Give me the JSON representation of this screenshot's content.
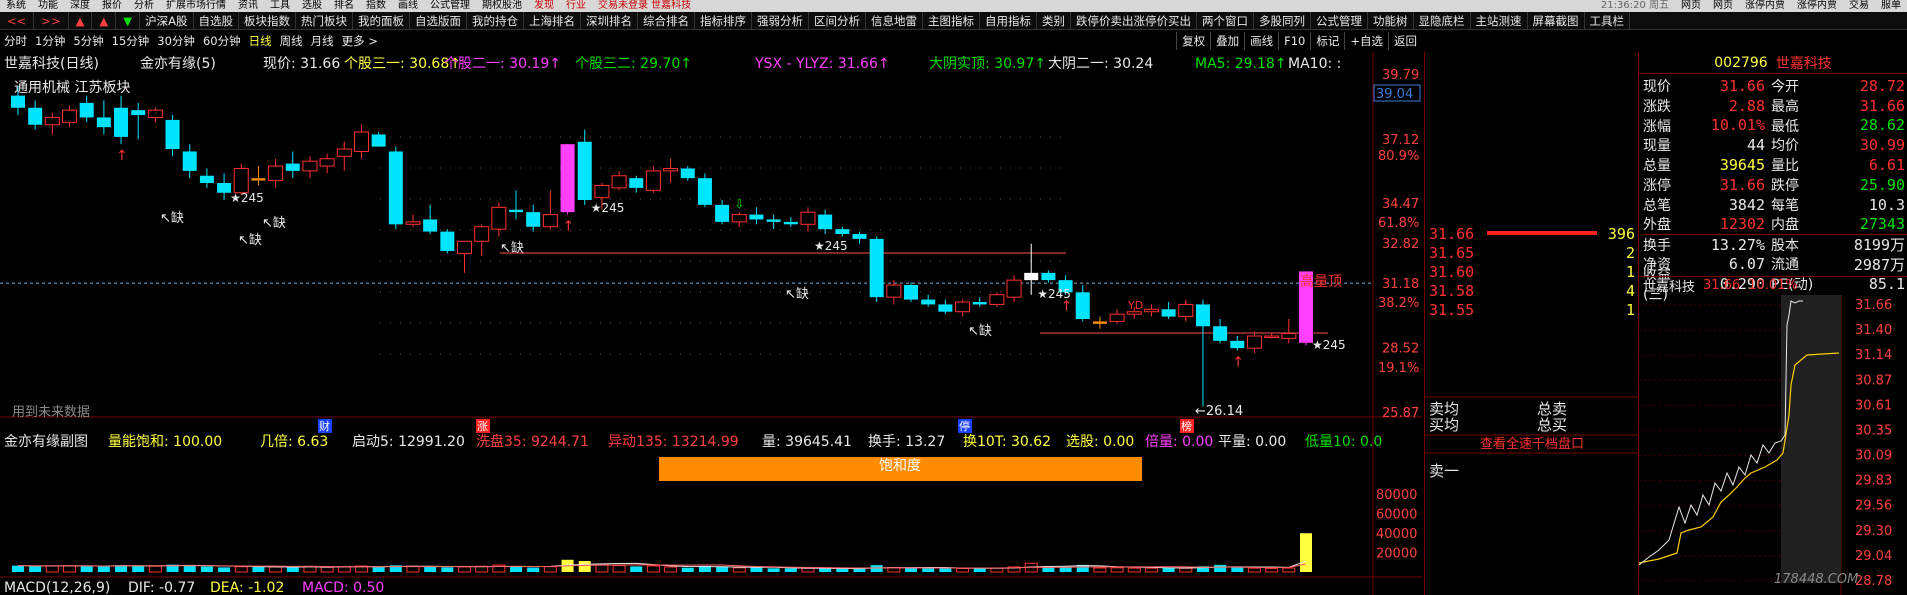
{
  "menubar": {
    "items": [
      "系统",
      "功能",
      "深度",
      "报价",
      "分析",
      "扩展市场行情",
      "资讯",
      "工具",
      "选股",
      "排名",
      "指数",
      "画线",
      "公式管理",
      "期权股池",
      "发现",
      "行业"
    ],
    "warning": "交易未登录   世嘉科技",
    "clock": "21:36:20 周五",
    "right": [
      "网页",
      "网页",
      "涨停内贾",
      "涨停内贾",
      "交易",
      "服单"
    ]
  },
  "toolbar1": {
    "nav": [
      "<<",
      ">>",
      "▲",
      "▲",
      "▼"
    ],
    "items": [
      "沪深A股",
      "自选股",
      "板块指数",
      "热门板块",
      "我的面板",
      "自选版面",
      "我的持仓",
      "上海排名",
      "深圳排名",
      "综合排名",
      "指标排序",
      "强弱分析",
      "区间分析",
      "信息地雷",
      "主图指标",
      "自用指标",
      "类别",
      "跌停价卖出涨停价买出",
      "两个窗口",
      "多股同列",
      "公式管理",
      "功能树",
      "显隐底栏",
      "主站测速",
      "屏幕截图",
      "工具栏"
    ]
  },
  "toolbar2": {
    "periods": [
      "分时",
      "1分钟",
      "5分钟",
      "15分钟",
      "30分钟",
      "60分钟",
      "日线",
      "周线",
      "月线",
      "更多 >"
    ],
    "active": "日线",
    "right": [
      "复权",
      "叠加",
      "画线",
      "F10",
      "标记",
      "+自选",
      "返回"
    ]
  },
  "chart": {
    "title": "世嘉科技(日线)",
    "formula": "金亦有缘(5)",
    "price_label": "现价: 31.66",
    "ind1": "个股三一: 30.68",
    "ind2": "个股二一: 30.19",
    "ind3": "个股三二: 29.70",
    "ysx": "YSX - YLYZ: 31.66",
    "dayin": "大阴实顶: 30.97",
    "dayin2": "大阴二一: 30.24",
    "ma5": "MA5: 29.18",
    "ma10": "MA10: :",
    "sector": "通用机械  江苏板块",
    "future_note": "用到未来数据",
    "price_axis": [
      "39.79",
      "37.12",
      "34.47",
      "32.82",
      "31.18",
      "28.52",
      "25.87"
    ],
    "pct_axis": [
      "80.9%",
      "61.8%",
      "38.2%",
      "19.1%"
    ],
    "current_price_tag": "39.04",
    "high_volume_label": "高量顶",
    "low_label": "26.14",
    "gap_label": "缺",
    "bottom_tags": [
      "财",
      "涨",
      "停",
      "榜"
    ],
    "vol_axis": [
      "80000",
      "60000",
      "40000",
      "20000"
    ]
  },
  "sub_chart": {
    "title": "金亦有缘副图",
    "items": [
      {
        "text": "量能饱和: 100.00",
        "color": "#ffff40"
      },
      {
        "text": "几倍: 6.63",
        "color": "#ffff40"
      },
      {
        "text": "启动5: 12991.20",
        "color": "#e8e8e8"
      },
      {
        "text": "洗盘35: 9244.71",
        "color": "#ff4040"
      },
      {
        "text": "异动135: 13214.99",
        "color": "#ff4040"
      },
      {
        "text": "量: 39645.41",
        "color": "#e8e8e8"
      },
      {
        "text": "换手: 13.27",
        "color": "#e8e8e8"
      },
      {
        "text": "换10T: 30.62",
        "color": "#ffff40"
      },
      {
        "text": "选股: 0.00",
        "color": "#ffff40"
      },
      {
        "text": "倍量: 0.00",
        "color": "#ff40ff"
      },
      {
        "text": "平量: 0.00",
        "color": "#e8e8e8"
      },
      {
        "text": "低量10: 0.0",
        "color": "#00e000"
      }
    ],
    "saturation_label": "饱和度"
  },
  "macd": {
    "name": "MACD(12,26,9)",
    "dif": "DIF: -0.77",
    "dea": "DEA: -1.02",
    "macd": "MACD: 0.50"
  },
  "order_book": {
    "sells": [
      {
        "price": "31.66",
        "vol": "396"
      },
      {
        "price": "31.65",
        "vol": "2"
      },
      {
        "price": "31.60",
        "vol": "1"
      },
      {
        "price": "31.58",
        "vol": "4"
      },
      {
        "price": "31.55",
        "vol": "1"
      }
    ],
    "sell_avg": "卖均",
    "buy_avg": "买均",
    "total_sell": "总卖",
    "total_buy": "总买",
    "view_all": "查看全速千档盘口",
    "sell_one": "卖一"
  },
  "quote": {
    "code": "002796",
    "name": "世嘉科技",
    "rows": [
      {
        "l1": "现价",
        "v1": "31.66",
        "c1": "red",
        "l2": "今开",
        "v2": "28.72",
        "c2": "red"
      },
      {
        "l1": "涨跌",
        "v1": "2.88",
        "c1": "red",
        "l2": "最高",
        "v2": "31.66",
        "c2": "red"
      },
      {
        "l1": "涨幅",
        "v1": "10.01%",
        "c1": "red",
        "l2": "最低",
        "v2": "28.62",
        "c2": "green"
      },
      {
        "l1": "现量",
        "v1": "44",
        "c1": "white",
        "l2": "均价",
        "v2": "30.99",
        "c2": "red"
      },
      {
        "l1": "总量",
        "v1": "39645",
        "c1": "yellow",
        "l2": "量比",
        "v2": "6.61",
        "c2": "red"
      },
      {
        "l1": "涨停",
        "v1": "31.66",
        "c1": "red",
        "l2": "跌停",
        "v2": "25.90",
        "c2": "green"
      },
      {
        "l1": "总笔",
        "v1": "3842",
        "c1": "white",
        "l2": "每笔",
        "v2": "10.3",
        "c2": "white"
      },
      {
        "l1": "外盘",
        "v1": "12302",
        "c1": "red",
        "l2": "内盘",
        "v2": "27343",
        "c2": "green"
      },
      {
        "l1": "换手",
        "v1": "13.27%",
        "c1": "white",
        "l2": "股本",
        "v2": "8199万",
        "c2": "white"
      },
      {
        "l1": "净资",
        "v1": "6.07",
        "c1": "white",
        "l2": "流通",
        "v2": "2987万",
        "c2": "white"
      },
      {
        "l1": "收益(三)",
        "v1": "0.290",
        "c1": "white",
        "l2": "PE(动)",
        "v2": "85.1",
        "c2": "white"
      }
    ],
    "mini_title": "世嘉科技",
    "mini_price": "31.66",
    "mini_pct": "10.01%",
    "mini_axis": [
      "31.66",
      "31.40",
      "31.14",
      "30.87",
      "30.61",
      "30.35",
      "30.09",
      "29.83",
      "29.56",
      "29.30",
      "29.04",
      "28.78"
    ],
    "watermark": "178448.COM"
  },
  "colors": {
    "up": "#ff3030",
    "down": "#00e5ff",
    "yellow": "#ffff40",
    "magenta": "#ff40ff",
    "green": "#00e000",
    "orange": "#ff8c00"
  },
  "chart_data": {
    "type": "candlestick",
    "title": "世嘉科技(日线)",
    "ylim": [
      25.87,
      39.79
    ],
    "candles": [
      [
        38.9,
        39.3,
        38.1,
        38.4
      ],
      [
        38.4,
        38.7,
        37.5,
        37.7
      ],
      [
        37.7,
        38.2,
        37.3,
        38.0
      ],
      [
        37.8,
        38.5,
        37.6,
        38.3
      ],
      [
        38.6,
        38.9,
        37.8,
        38.0
      ],
      [
        38.0,
        38.7,
        37.3,
        37.6
      ],
      [
        38.4,
        38.9,
        36.9,
        37.2
      ],
      [
        38.3,
        38.6,
        37.1,
        38.1
      ],
      [
        38.0,
        38.4,
        37.8,
        38.3
      ],
      [
        37.9,
        38.1,
        36.4,
        36.7
      ],
      [
        36.6,
        36.9,
        35.5,
        35.8
      ],
      [
        35.6,
        35.9,
        35.1,
        35.3
      ],
      [
        35.3,
        35.7,
        34.6,
        34.9
      ],
      [
        34.9,
        36.1,
        34.8,
        35.9
      ],
      [
        35.5,
        36.0,
        35.2,
        35.4
      ],
      [
        35.4,
        36.3,
        35.1,
        36.0
      ],
      [
        36.1,
        36.6,
        35.5,
        35.8
      ],
      [
        35.8,
        36.4,
        35.5,
        36.2
      ],
      [
        36.0,
        36.5,
        35.7,
        36.3
      ],
      [
        36.4,
        37.0,
        35.8,
        36.7
      ],
      [
        36.6,
        37.7,
        36.3,
        37.4
      ],
      [
        37.3,
        37.4,
        36.8,
        36.8
      ],
      [
        36.6,
        36.8,
        33.4,
        33.6
      ],
      [
        33.6,
        34.0,
        33.5,
        33.7
      ],
      [
        33.8,
        34.4,
        33.2,
        33.3
      ],
      [
        33.3,
        33.4,
        32.4,
        32.5
      ],
      [
        32.4,
        32.9,
        31.6,
        32.9
      ],
      [
        32.9,
        33.6,
        32.3,
        33.5
      ],
      [
        33.4,
        34.5,
        33.1,
        34.3
      ],
      [
        34.2,
        35.0,
        33.8,
        34.1
      ],
      [
        34.1,
        34.4,
        33.3,
        33.5
      ],
      [
        33.5,
        35.0,
        33.4,
        34.0
      ],
      [
        34.1,
        36.9,
        34.0,
        36.9
      ],
      [
        37.0,
        37.5,
        34.4,
        34.6
      ],
      [
        34.7,
        35.3,
        34.2,
        35.2
      ],
      [
        35.1,
        35.8,
        35.0,
        35.6
      ],
      [
        35.5,
        35.6,
        34.9,
        35.1
      ],
      [
        35.0,
        36.0,
        34.9,
        35.8
      ],
      [
        35.8,
        36.3,
        35.3,
        35.9
      ],
      [
        35.9,
        36.0,
        35.4,
        35.5
      ],
      [
        35.5,
        35.7,
        34.3,
        34.4
      ],
      [
        34.4,
        34.6,
        33.6,
        33.7
      ],
      [
        33.7,
        34.1,
        33.5,
        34.0
      ],
      [
        34.0,
        34.3,
        33.6,
        33.8
      ],
      [
        33.8,
        34.0,
        33.4,
        33.7
      ],
      [
        33.7,
        33.9,
        33.5,
        33.6
      ],
      [
        33.6,
        34.3,
        33.3,
        34.1
      ],
      [
        34.0,
        34.2,
        33.2,
        33.4
      ],
      [
        33.4,
        33.5,
        33.1,
        33.2
      ],
      [
        33.2,
        33.3,
        32.8,
        33.0
      ],
      [
        33.0,
        33.1,
        30.4,
        30.6
      ],
      [
        30.6,
        31.3,
        30.3,
        31.1
      ],
      [
        31.1,
        31.2,
        30.4,
        30.5
      ],
      [
        30.5,
        30.7,
        30.2,
        30.3
      ],
      [
        30.3,
        30.5,
        29.9,
        30.0
      ],
      [
        30.0,
        30.5,
        29.8,
        30.4
      ],
      [
        30.4,
        30.6,
        30.2,
        30.3
      ],
      [
        30.3,
        30.8,
        30.2,
        30.7
      ],
      [
        30.6,
        31.5,
        30.4,
        31.3
      ],
      [
        31.3,
        32.8,
        30.7,
        31.6
      ],
      [
        31.6,
        31.7,
        31.2,
        31.3
      ],
      [
        31.3,
        31.5,
        30.7,
        30.8
      ],
      [
        30.8,
        31.1,
        29.6,
        29.7
      ],
      [
        29.5,
        29.8,
        29.3,
        29.6
      ],
      [
        29.6,
        30.1,
        29.5,
        29.9
      ],
      [
        29.9,
        30.2,
        29.7,
        30.0
      ],
      [
        30.0,
        30.3,
        29.8,
        30.1
      ],
      [
        30.1,
        30.4,
        29.7,
        29.8
      ],
      [
        29.8,
        30.5,
        29.6,
        30.3
      ],
      [
        30.3,
        30.5,
        26.1,
        29.4
      ],
      [
        29.4,
        29.7,
        28.7,
        28.8
      ],
      [
        28.8,
        29.0,
        28.4,
        28.5
      ],
      [
        28.5,
        29.2,
        28.3,
        29.0
      ],
      [
        29.0,
        29.1,
        28.9,
        29.0
      ],
      [
        28.9,
        29.7,
        28.7,
        29.1
      ],
      [
        28.72,
        31.66,
        28.62,
        31.66
      ]
    ],
    "volumes": [
      6500,
      6000,
      6200,
      6400,
      6300,
      5800,
      7000,
      6600,
      5900,
      7500,
      6800,
      5600,
      4700,
      5400,
      5200,
      5100,
      4900,
      5800,
      4800,
      5300,
      6100,
      5500,
      6800,
      6000,
      5200,
      4800,
      5200,
      5900,
      7100,
      5500,
      4600,
      5400,
      12500,
      11200,
      8100,
      6500,
      5700,
      6200,
      5100,
      4400,
      6200,
      5200,
      4300,
      4500,
      3800,
      3600,
      3900,
      3500,
      3300,
      3200,
      7000,
      4700,
      4100,
      3800,
      3600,
      3600,
      3900,
      4100,
      5200,
      9000,
      5800,
      5300,
      7300,
      4100,
      4300,
      3900,
      3900,
      4600,
      3800,
      5800,
      7300,
      4900,
      3900,
      3600,
      4000,
      39645
    ],
    "vol_ylim": [
      0,
      90000
    ]
  }
}
